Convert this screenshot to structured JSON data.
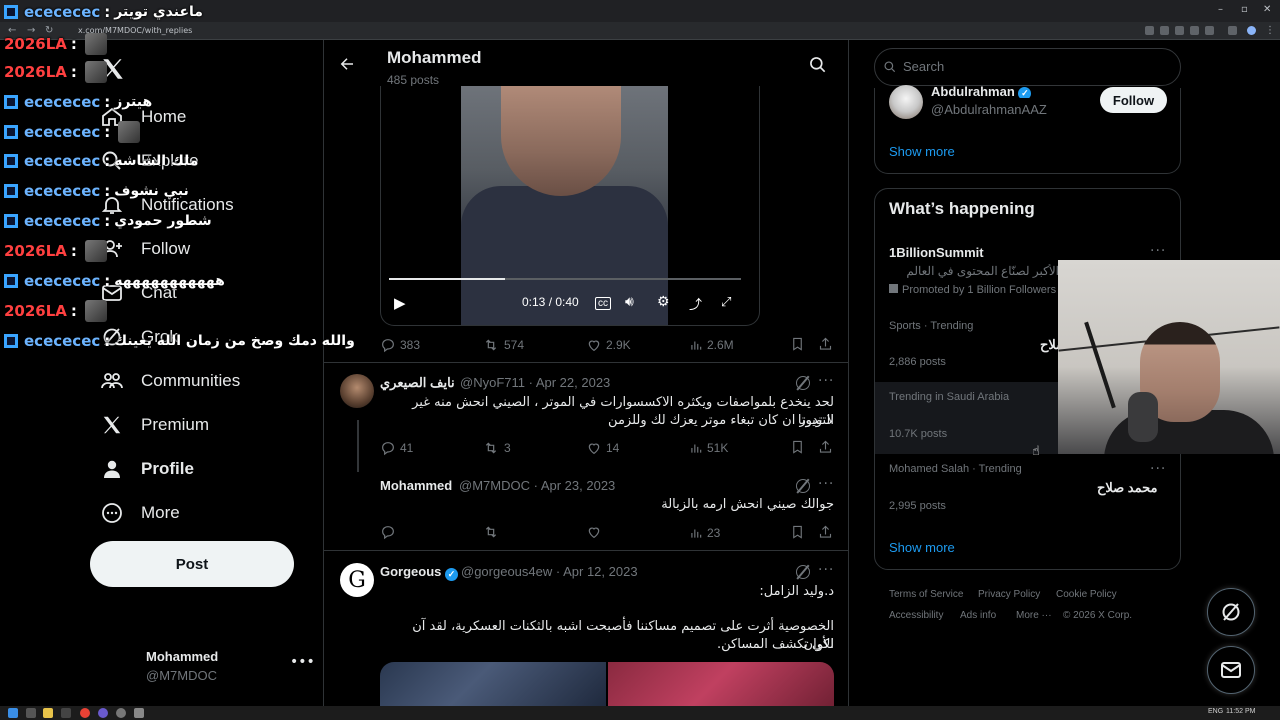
{
  "browser": {
    "url": "x.com/M7MDOC/with_replies",
    "tab_title": "X"
  },
  "sidebar": {
    "items": [
      {
        "label": "Home",
        "icon": "home-icon"
      },
      {
        "label": "Explore",
        "icon": "search-icon"
      },
      {
        "label": "Notifications",
        "icon": "bell-icon"
      },
      {
        "label": "Follow",
        "icon": "person-add-icon"
      },
      {
        "label": "Chat",
        "icon": "mail-icon"
      },
      {
        "label": "Grok",
        "icon": "grok-icon"
      },
      {
        "label": "Communities",
        "icon": "communities-icon"
      },
      {
        "label": "Premium",
        "icon": "x-logo-icon"
      },
      {
        "label": "Profile",
        "icon": "person-icon"
      },
      {
        "label": "More",
        "icon": "more-circle-icon"
      }
    ],
    "post_label": "Post",
    "account": {
      "name": "Mohammed",
      "handle": "@M7MDOC"
    }
  },
  "header": {
    "name": "Mohammed",
    "post_count": "485 posts"
  },
  "video": {
    "time": "0:13 / 0:40",
    "progress": 0.33
  },
  "tweet1_actions": {
    "replies": "383",
    "reposts": "574",
    "likes": "2.9K",
    "views": "2.6M"
  },
  "reply1": {
    "name": "نايف الصيعري",
    "handle": "@NyoF711",
    "date": "· Apr 22, 2023",
    "text_line1": "لحد ينخدع بلمواصفات ويكثره الاكسسوارات في الموتر ، الصيني انحش منه غير التويوتا",
    "text_line2": "لا تدور ان كان تبغاء موتر يعزك لك وللزمن",
    "replies": "41",
    "reposts": "3",
    "likes": "14",
    "views": "51K"
  },
  "reply2": {
    "name": "Mohammed",
    "handle": "@M7MDOC",
    "date": "· Apr 23, 2023",
    "text": "جوالك صيني انحش ارمه بالزبالة",
    "views": "23"
  },
  "tweet3": {
    "name": "Gorgeous",
    "handle": "@gorgeous4ew",
    "date": "· Apr 12, 2023",
    "line1": "د.وليد الزامل:",
    "line2": "الخصوصية أثرت على تصميم مساكننا فأصبحت اشبه بالثكنات العسكرية، لقد آن الأوان",
    "line3": "لكي تكشف المساكن."
  },
  "right": {
    "search_placeholder": "Search",
    "suggest": {
      "name": "Abdulrahman",
      "handle": "@AbdulrahmanAAZ",
      "follow_label": "Follow"
    },
    "show_more": "Show more",
    "whats_happening": "What’s happening",
    "trends": [
      {
        "top": "1BillionSummit",
        "line2": "الأكبر لصنّاع المحتوى في العالم",
        "line3": "Promoted by 1 Billion Followers"
      },
      {
        "top": "Sports · Trending",
        "title": "صلاح",
        "count": "2,886 posts"
      },
      {
        "top": "Trending in Saudi Arabia",
        "title": "",
        "count": "10.7K posts"
      },
      {
        "top": "Mohamed Salah · Trending",
        "title": "محمد صلاح",
        "count": "2,995 posts"
      }
    ],
    "show_more_2": "Show more",
    "footer": [
      "Terms of Service",
      "Privacy Policy",
      "Cookie Policy",
      "Accessibility",
      "Ads info",
      "More ···",
      "© 2026 X Corp."
    ]
  },
  "chat": [
    {
      "user": "ecececec",
      "msg": "ماعندي تويتر",
      "color": "#6cb4ff",
      "badge": true,
      "thumb": false
    },
    {
      "user": "2026LA",
      "msg": "",
      "color": "#ff4040",
      "badge": false,
      "thumb": true
    },
    {
      "user": "2026LA",
      "msg": "",
      "color": "#ff4040",
      "badge": false,
      "thumb": true
    },
    {
      "user": "ecececec",
      "msg": "هيترز",
      "color": "#6cb4ff",
      "badge": true,
      "thumb": false
    },
    {
      "user": "ecececec",
      "msg": "",
      "color": "#6cb4ff",
      "badge": true,
      "thumb": true
    },
    {
      "user": "ecececec",
      "msg": "ملك الشاشه",
      "color": "#6cb4ff",
      "badge": true,
      "thumb": false
    },
    {
      "user": "ecececec",
      "msg": "نبي نشوف",
      "color": "#6cb4ff",
      "badge": true,
      "thumb": false
    },
    {
      "user": "ecececec",
      "msg": "شطور حمودي",
      "color": "#6cb4ff",
      "badge": true,
      "thumb": false
    },
    {
      "user": "2026LA",
      "msg": "",
      "color": "#ff4040",
      "badge": false,
      "thumb": true
    },
    {
      "user": "ecececec",
      "msg": "هههههههههههه",
      "color": "#6cb4ff",
      "badge": true,
      "thumb": false
    },
    {
      "user": "2026LA",
      "msg": "",
      "color": "#ff4040",
      "badge": false,
      "thumb": true
    },
    {
      "user": "ecececec",
      "msg": "والله دمك وصخ من زمان الله يعينك",
      "color": "#6cb4ff",
      "badge": true,
      "thumb": false
    }
  ],
  "taskbar": {
    "lang": "ENG",
    "time": "11:52 PM"
  }
}
